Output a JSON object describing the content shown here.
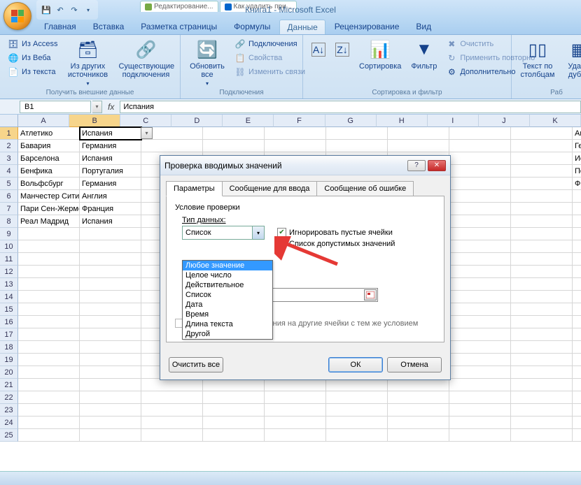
{
  "title": "Книга1 - Microsoft Excel",
  "browser_tabs": [
    "Редактирование...",
    "Как удалить при..."
  ],
  "ribbon_tabs": [
    "Главная",
    "Вставка",
    "Разметка страницы",
    "Формулы",
    "Данные",
    "Рецензирование",
    "Вид"
  ],
  "active_ribbon_tab": "Данные",
  "groups": {
    "external": {
      "label": "Получить внешние данные",
      "items": {
        "access": "Из Access",
        "web": "Из Веба",
        "text": "Из текста",
        "other": "Из других источников",
        "existing": "Существующие подключения"
      }
    },
    "connections": {
      "label": "Подключения",
      "refresh": "Обновить все",
      "conn": "Подключения",
      "props": "Свойства",
      "editlinks": "Изменить связи"
    },
    "sortfilter": {
      "label": "Сортировка и фильтр",
      "sort": "Сортировка",
      "filter": "Фильтр",
      "clear": "Очистить",
      "reapply": "Применить повторно",
      "advanced": "Дополнительно"
    },
    "datatools": {
      "label": "Раб",
      "ttc": "Текст по столбцам",
      "dup": "Удали дубли"
    }
  },
  "namebox": "B1",
  "formula": "Испания",
  "cols": [
    "A",
    "B",
    "C",
    "D",
    "E",
    "F",
    "G",
    "H",
    "I",
    "J",
    "K"
  ],
  "row_count": 25,
  "active_cell": {
    "row": 0,
    "col": 1
  },
  "data_a": [
    "Атлетико",
    "Бавария",
    "Барселона",
    "Бенфика",
    "Вольфсбург",
    "Манчестер Сити",
    "Пари Сен-Жермен",
    "Реал Мадрид"
  ],
  "data_b": [
    "Испания",
    "Германия",
    "Испания",
    "Португалия",
    "Германия",
    "Англия",
    "Франция",
    "Испания"
  ],
  "data_j": [
    "Англия",
    "Германия",
    "Испания",
    "Португалия",
    "Франция"
  ],
  "dialog": {
    "title": "Проверка вводимых значений",
    "tabs": [
      "Параметры",
      "Сообщение для ввода",
      "Сообщение об ошибке"
    ],
    "cond_label": "Условие проверки",
    "type_label": "Тип данных:",
    "type_value": "Список",
    "chk_ignore": "Игнорировать пустые ячейки",
    "chk_dropdown": "Список допустимых значений",
    "propagate": "Распространить изменения на другие ячейки с тем же условием",
    "clear": "Очистить все",
    "ok": "ОК",
    "cancel": "Отмена",
    "list": [
      "Любое значение",
      "Целое число",
      "Действительное",
      "Список",
      "Дата",
      "Время",
      "Длина текста",
      "Другой"
    ]
  }
}
